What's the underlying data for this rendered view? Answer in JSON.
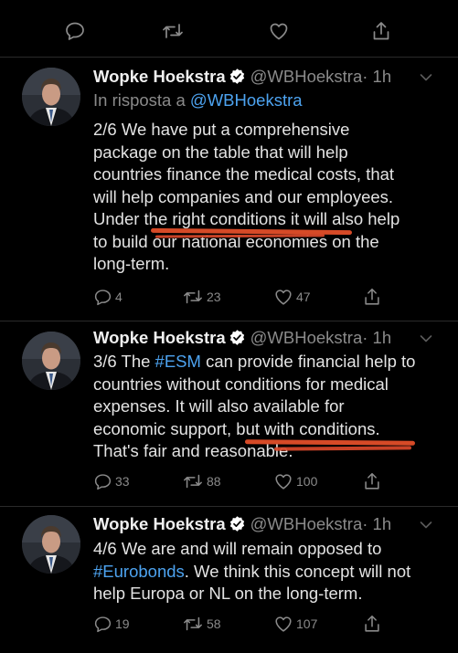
{
  "tweets": [
    {
      "name": "Wopke Hoekstra",
      "handle": "@WBHoekstra",
      "time": "· 1h",
      "reply_prefix": "In risposta a",
      "reply_handle": "@WBHoekstra",
      "lines": [
        "2/6 We have put a comprehensive",
        "package on the table that will help",
        "countries finance the medical costs, that",
        "will help companies and our employees.",
        "Under the right conditions it will also help",
        "to build our national economies on the",
        "long-term."
      ],
      "replies": "4",
      "retweets": "23",
      "likes": "47"
    },
    {
      "name": "Wopke Hoekstra",
      "handle": "@WBHoekstra",
      "time": "· 1h",
      "line1_pre": "3/6 The ",
      "line1_tag": "#ESM",
      "line1_post": " can provide financial help to",
      "lines": [
        "countries without conditions for medical",
        "expenses. It will also available for",
        "economic support, but with conditions.",
        "That's fair and reasonable."
      ],
      "replies": "33",
      "retweets": "88",
      "likes": "100"
    },
    {
      "name": "Wopke Hoekstra",
      "handle": "@WBHoekstra",
      "time": "· 1h",
      "line1": "4/6 We are and will remain opposed to",
      "line2_tag": "#Eurobonds",
      "line2_post": ". We think this concept will not",
      "lines": [
        "help Europa or NL on the long-term."
      ],
      "replies": "19",
      "retweets": "58",
      "likes": "107"
    }
  ],
  "colors": {
    "background": "#000000",
    "text": "#e3e3e3",
    "muted": "#8a8a8a",
    "link": "#4da3f0",
    "verified": "#ffffff",
    "annotation": "#e8502a"
  },
  "icons": [
    "reply-icon",
    "retweet-icon",
    "like-icon",
    "share-icon",
    "verified-badge-icon",
    "chevron-down-icon"
  ]
}
